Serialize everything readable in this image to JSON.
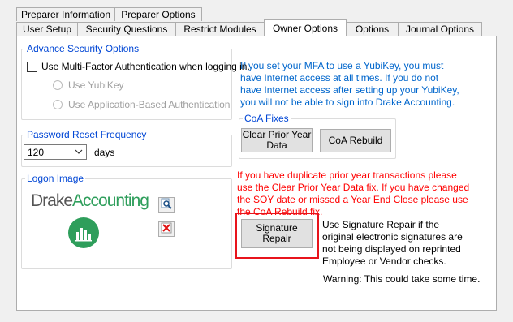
{
  "tabs_row1": [
    {
      "label": "Preparer Information"
    },
    {
      "label": "Preparer Options"
    }
  ],
  "tabs_row2": [
    {
      "label": "User Setup"
    },
    {
      "label": "Security Questions"
    },
    {
      "label": "Restrict Modules"
    },
    {
      "label": "Owner Options"
    },
    {
      "label": "Options"
    },
    {
      "label": "Journal Options"
    }
  ],
  "security": {
    "legend": "Advance Security Options",
    "mfa_label": "Use Multi-Factor Authentication when logging in.",
    "mfa_checked": false,
    "radio_yubikey": "Use YubiKey",
    "radio_app": "Use Application-Based Authentication"
  },
  "password": {
    "legend": "Password Reset Frequency",
    "value": "120",
    "unit": "days"
  },
  "logon": {
    "legend": "Logon Image",
    "logo_text_1": "Drake",
    "logo_text_2": "Accounting"
  },
  "mfa_note": "If you set your MFA to use a YubiKey, you must have Internet access at all times. If you do not have Internet access after setting up your YubiKey, you will not be able to sign into Drake Accounting.",
  "coa": {
    "legend": "CoA Fixes",
    "clear_label": "Clear Prior Year Data",
    "rebuild_label": "CoA Rebuild"
  },
  "duplicate_note": "If you have duplicate prior year transactions please use the Clear Prior Year Data fix. If you have changed the SOY date or missed a Year End Close please use the CoA Rebuild fix.",
  "signature": {
    "button_label": "Signature Repair",
    "description": "Use Signature Repair if the original electronic signatures are not being displayed on reprinted Employee or Vendor checks.",
    "warning": "Warning: This could take some time."
  },
  "colors": {
    "legend_blue": "#0046d5",
    "note_blue": "#0066cc",
    "note_red": "#ff0000",
    "highlight_red": "#e8141c",
    "logo_green": "#2e9e5b"
  }
}
